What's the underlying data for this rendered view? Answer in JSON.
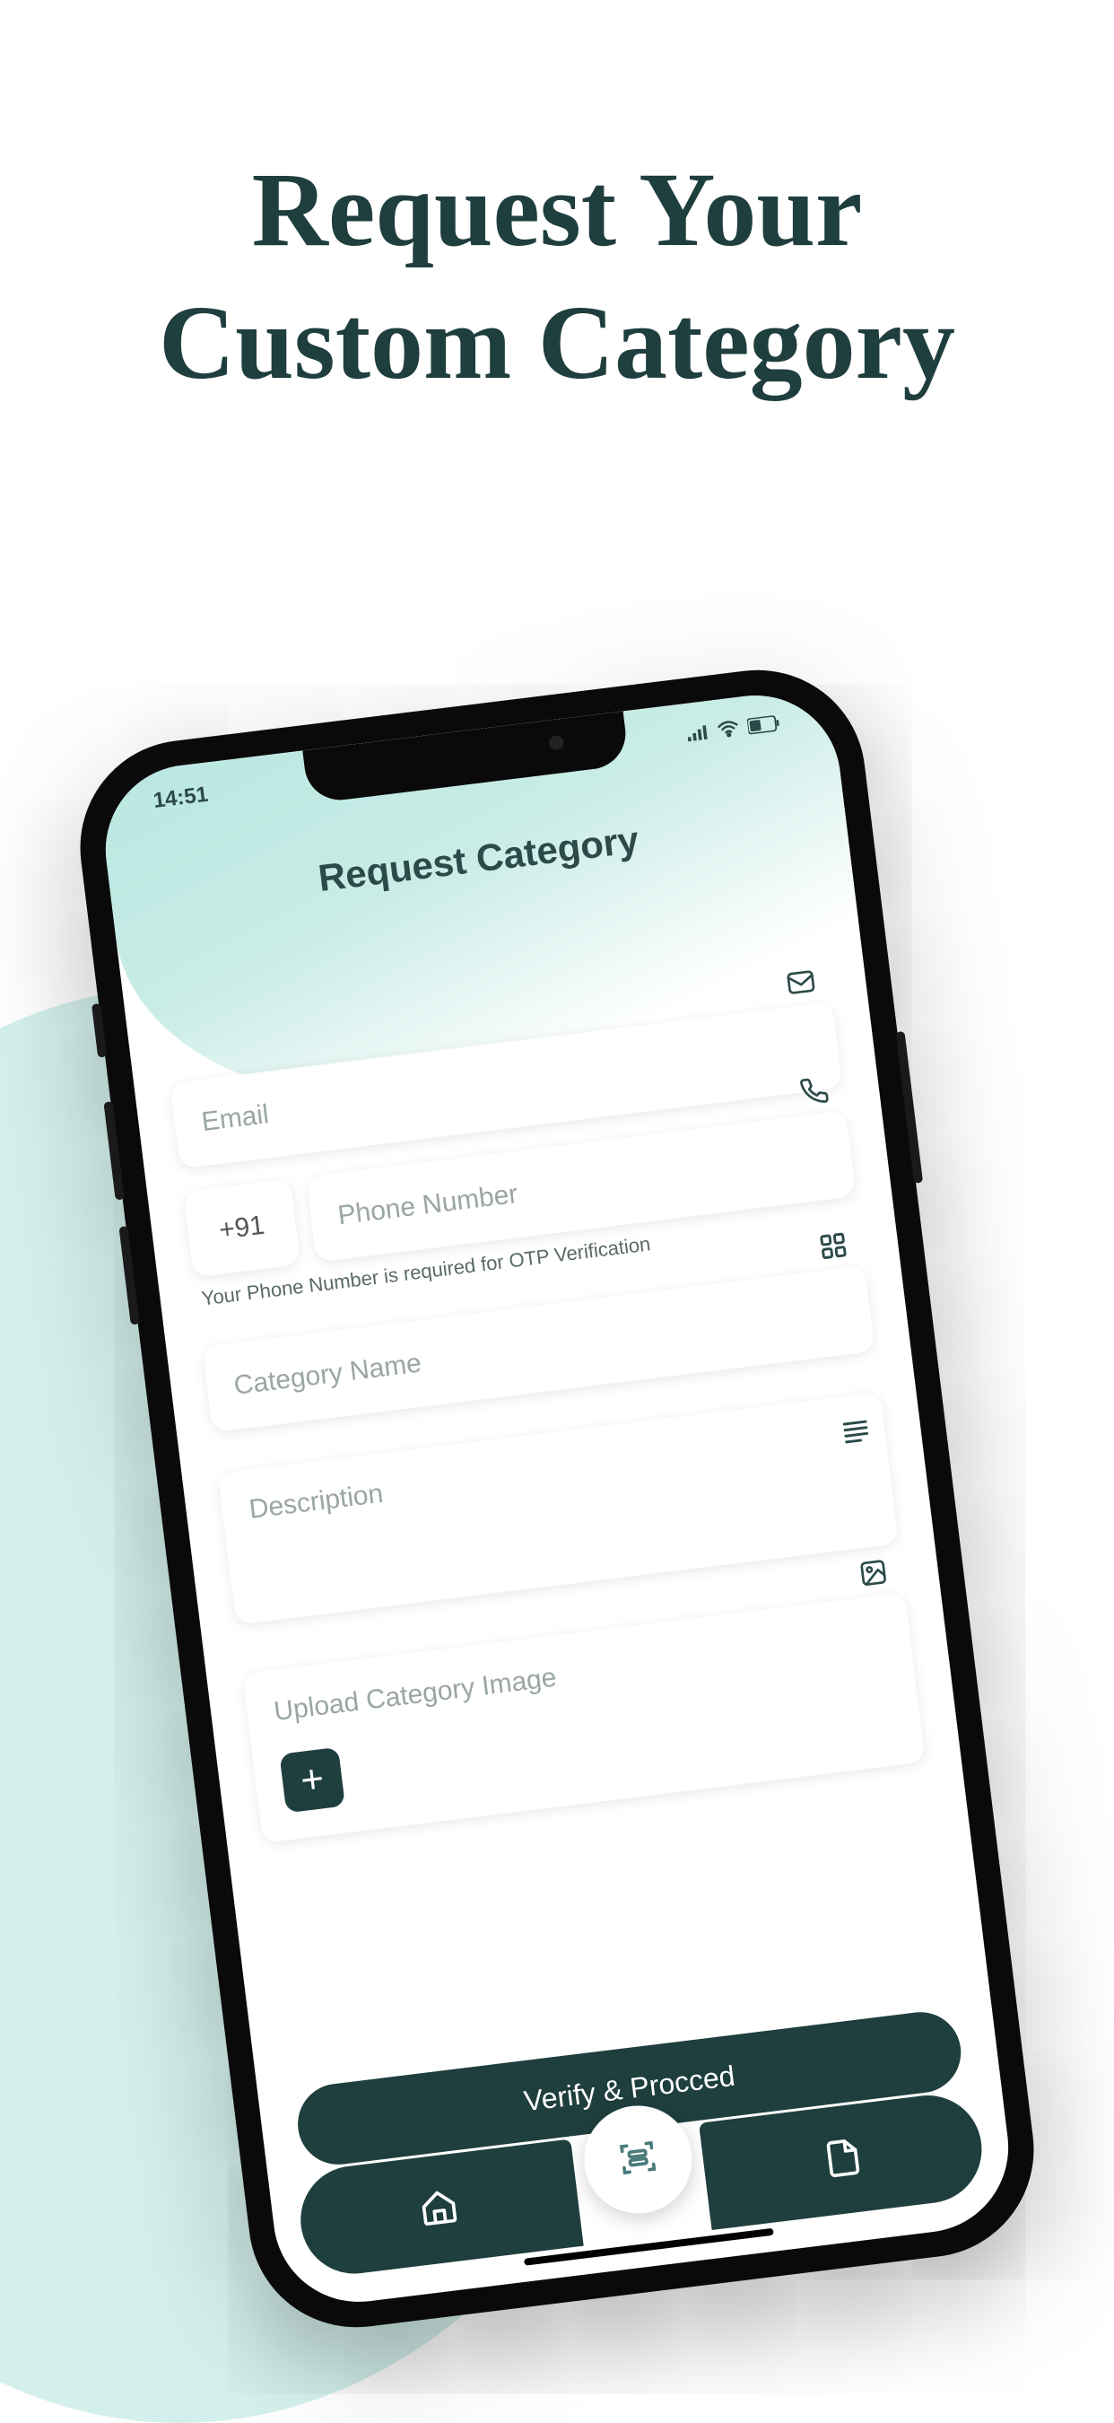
{
  "marketing": {
    "title_line1": "Request Your",
    "title_line2": "Custom Category"
  },
  "status": {
    "time": "14:51",
    "battery": "40"
  },
  "page": {
    "title": "Request Category"
  },
  "form": {
    "email": {
      "placeholder": "Email",
      "value": ""
    },
    "country_code": "+91",
    "phone": {
      "placeholder": "Phone Number",
      "value": ""
    },
    "phone_helper": "Your Phone Number is required for OTP Verification",
    "category": {
      "placeholder": "Category Name",
      "value": ""
    },
    "description": {
      "placeholder": "Description",
      "value": ""
    },
    "upload_label": "Upload Category Image"
  },
  "submit_label": "Verify & Procced",
  "icons": {
    "mail": "mail-icon",
    "phone": "phone-icon",
    "grid": "grid-icon",
    "lines": "lines-icon",
    "image": "image-icon",
    "plus": "+",
    "home": "home-icon",
    "scan": "scan-icon",
    "document": "document-icon"
  },
  "colors": {
    "brand_dark": "#1f3e3e",
    "header_gradient": "#b9e8e1",
    "bg_blob": "#d4f0ec"
  }
}
